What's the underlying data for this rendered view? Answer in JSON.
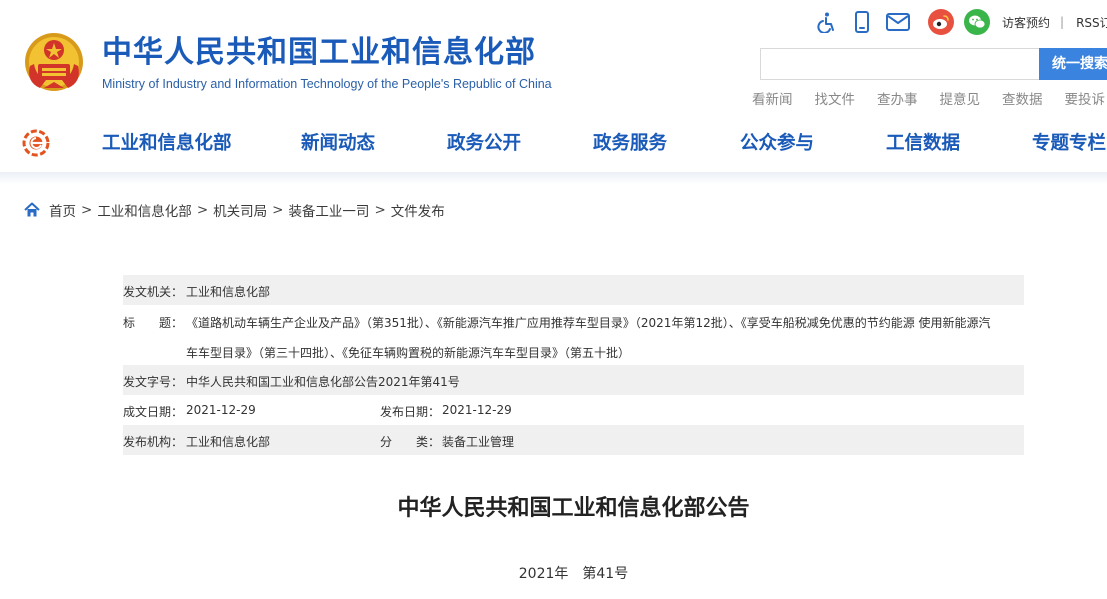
{
  "header": {
    "site_title": "中华人民共和国工业和信息化部",
    "site_subtitle": "Ministry of Industry and Information Technology of the People's Republic of China"
  },
  "tools": {
    "icons": [
      "accessibility-icon",
      "mobile-icon",
      "mail-icon",
      "weibo-icon",
      "wechat-icon"
    ],
    "visitor_booking": "访客预约",
    "separator": "|",
    "rss": "RSS订阅"
  },
  "search": {
    "placeholder": "",
    "button_label": "统一搜索"
  },
  "quick_links": [
    "看新闻",
    "找文件",
    "查办事",
    "提意见",
    "查数据",
    "要投诉"
  ],
  "nav": {
    "items": [
      "工业和信息化部",
      "新闻动态",
      "政务公开",
      "政务服务",
      "公众参与",
      "工信数据",
      "专题专栏"
    ]
  },
  "breadcrumb": [
    "首页",
    "工业和信息化部",
    "机关司局",
    "装备工业一司",
    "文件发布"
  ],
  "meta": {
    "issuer_label": "发文机关：",
    "issuer": "工业和信息化部",
    "title_label": "标　　题：",
    "title_line1": "《道路机动车辆生产企业及产品》（第351批）、《新能源汽车推广应用推荐车型目录》（2021年第12批）、《享受车船税减免优惠的节约能源 使用新能源汽",
    "title_line2": "车车型目录》（第三十四批）、《免征车辆购置税的新能源汽车车型目录》（第五十批）",
    "doc_no_label": "发文字号：",
    "doc_no": "中华人民共和国工业和信息化部公告2021年第41号",
    "created_label": "成文日期：",
    "created": "2021-12-29",
    "published_label": "发布日期：",
    "published": "2021-12-29",
    "org_label": "发布机构：",
    "org": "工业和信息化部",
    "category_label": "分　　类：",
    "category": "装备工业管理"
  },
  "article": {
    "title": "中华人民共和国工业和信息化部公告",
    "number": "2021年　第41号"
  },
  "colors": {
    "brand_blue": "#1a5ab8",
    "search_button": "#3a84e0",
    "row_gray": "#f0f0f0"
  }
}
